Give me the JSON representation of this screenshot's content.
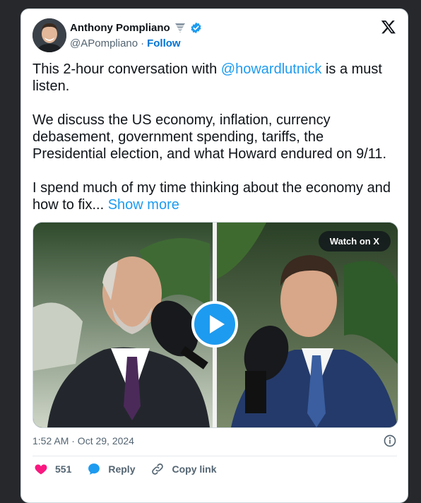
{
  "author": {
    "display_name": "Anthony Pompliano",
    "handle": "@APompliano",
    "separator": "·",
    "follow_label": "Follow"
  },
  "tweet": {
    "p1_before": "This 2-hour conversation with ",
    "mention": "@howardlutnick",
    "p1_after": " is a must listen.",
    "p2": "We discuss the US economy, inflation, currency debasement, government spending, tariffs, the Presidential election, and what Howard endured on 9/11.",
    "p3": "I spend much of my time thinking about the economy and how to fix...",
    "show_more": "Show more"
  },
  "media": {
    "watch_label": "Watch on X"
  },
  "meta": {
    "timestamp": "1:52 AM · Oct 29, 2024"
  },
  "actions": {
    "like_count": "551",
    "reply_label": "Reply",
    "copy_link_label": "Copy link"
  },
  "colors": {
    "link": "#1d9bf0",
    "like": "#f91880",
    "verified": "#1d9bf0"
  }
}
